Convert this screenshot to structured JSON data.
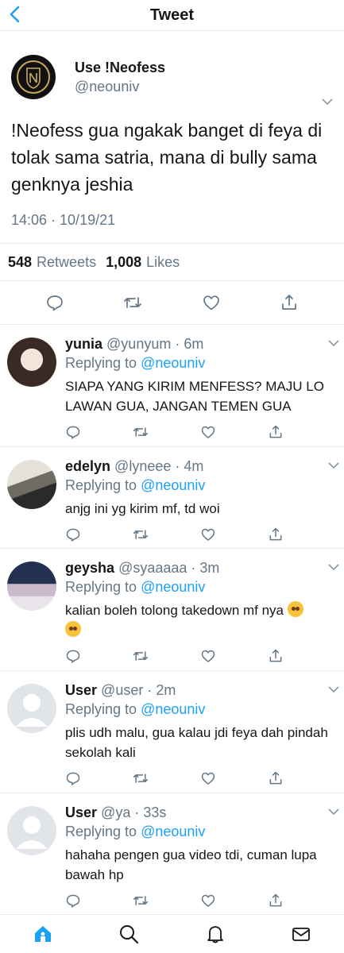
{
  "header": {
    "title": "Tweet"
  },
  "main_tweet": {
    "name": "Use !Neofess",
    "handle": "@neouniv",
    "text": "!Neofess gua ngakak banget di feya di tolak sama satria, mana di bully sama genknya jeshia",
    "timestamp": "14:06 · 10/19/21",
    "retweets": "548",
    "retweets_label": "Retweets",
    "likes": "1,008",
    "likes_label": "Likes"
  },
  "replying_label": "Replying to",
  "replying_handle": "@neouniv",
  "replies": [
    {
      "name": "yunia",
      "meta": "@yunyum · 6m",
      "text": "SIAPA YANG KIRIM MENFESS? MAJU LO LAWAN GUA, JANGAN TEMEN GUA"
    },
    {
      "name": "edelyn",
      "meta": "@lyneee · 4m",
      "text": "anjg ini yg kirim mf, td woi"
    },
    {
      "name": "geysha",
      "meta": "@syaaaaa · 3m",
      "text": "kalian boleh tolong takedown mf nya"
    },
    {
      "name": "User",
      "meta": "@user · 2m",
      "text": "plis udh malu, gua kalau jdi feya dah pindah sekolah kali"
    },
    {
      "name": "User",
      "meta": "@ya · 33s",
      "text": "hahaha pengen gua video tdi, cuman lupa bawah hp"
    }
  ],
  "colors": {
    "accent": "#1da1f2",
    "muted": "#657786",
    "border": "#e6ecf0"
  },
  "icons": [
    "back-chevron-icon",
    "reply-icon",
    "retweet-icon",
    "like-icon",
    "share-icon",
    "home-icon",
    "search-icon",
    "bell-icon",
    "mail-icon"
  ]
}
